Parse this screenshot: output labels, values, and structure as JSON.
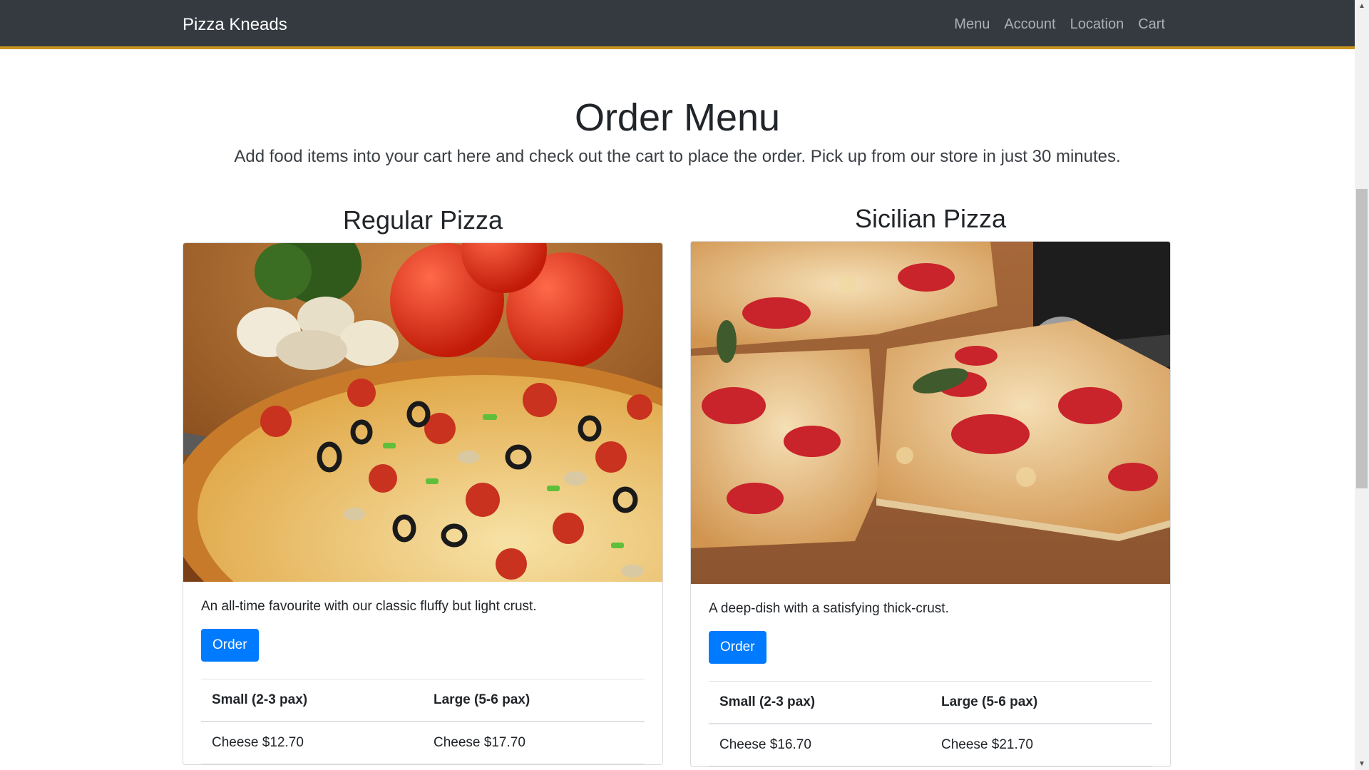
{
  "nav": {
    "brand": "Pizza Kneads",
    "links": [
      "Menu",
      "Account",
      "Location",
      "Cart"
    ]
  },
  "header": {
    "title": "Order Menu",
    "lead": "Add food items into your cart here and check out the cart to place the order. Pick up from our store in just 30 minutes."
  },
  "items": [
    {
      "title": "Regular Pizza",
      "description": "An all-time favourite with our classic fluffy but light crust.",
      "button": "Order",
      "columns": [
        "Small (2-3 pax)",
        "Large (5-6 pax)"
      ],
      "rows": [
        [
          "Cheese $12.70",
          "Cheese $17.70"
        ]
      ]
    },
    {
      "title": "Sicilian Pizza",
      "description": "A deep-dish with a satisfying thick-crust.",
      "button": "Order",
      "columns": [
        "Small (2-3 pax)",
        "Large (5-6 pax)"
      ],
      "rows": [
        [
          "Cheese $16.70",
          "Cheese $21.70"
        ]
      ]
    }
  ],
  "colors": {
    "navbar": "#343a40",
    "primary": "#007bff",
    "accent_stripe": "#c9921e"
  }
}
